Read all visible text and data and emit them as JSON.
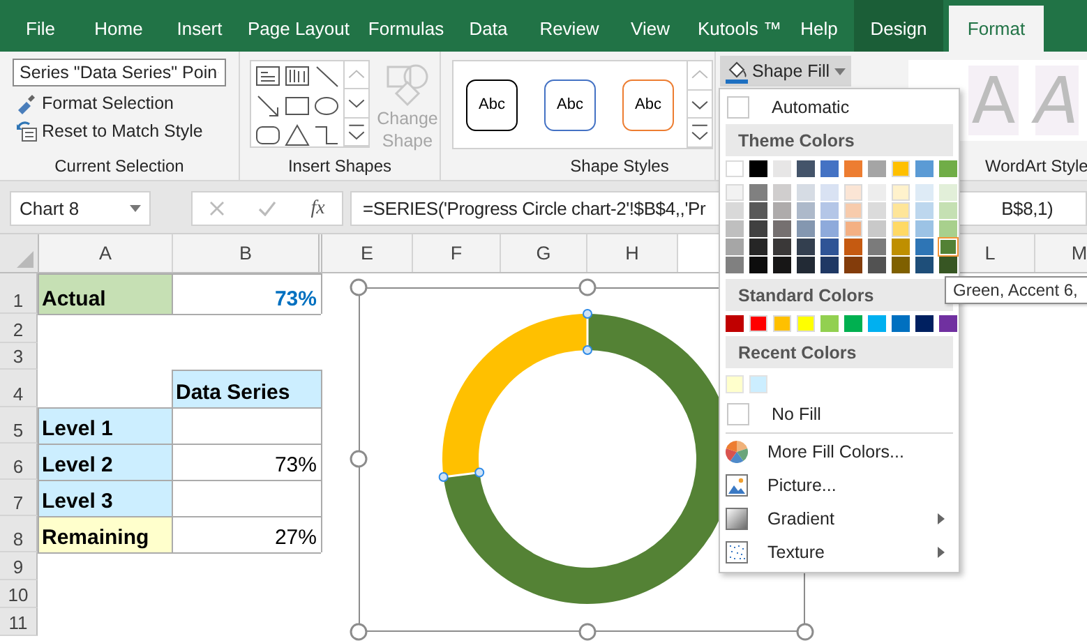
{
  "tabs": [
    {
      "label": "File",
      "kind": "normal",
      "selected": false
    },
    {
      "label": "Home",
      "kind": "normal",
      "selected": false
    },
    {
      "label": "Insert",
      "kind": "normal",
      "selected": false
    },
    {
      "label": "Page Layout",
      "kind": "normal",
      "selected": false
    },
    {
      "label": "Formulas",
      "kind": "normal",
      "selected": false
    },
    {
      "label": "Data",
      "kind": "normal",
      "selected": false
    },
    {
      "label": "Review",
      "kind": "normal",
      "selected": false
    },
    {
      "label": "View",
      "kind": "normal",
      "selected": false
    },
    {
      "label": "Kutools ™",
      "kind": "normal",
      "selected": false
    },
    {
      "label": "Help",
      "kind": "normal",
      "selected": false
    },
    {
      "label": "Design",
      "kind": "context",
      "selected": false
    },
    {
      "label": "Format",
      "kind": "context",
      "selected": true
    }
  ],
  "ribbon": {
    "current_selection": {
      "dropdown": "Series \"Data Series\" Poin",
      "format_selection": "Format Selection",
      "reset": "Reset to Match Style",
      "label": "Current Selection"
    },
    "insert_shapes": {
      "change_shape": {
        "label": "Change Shape",
        "disabled": true
      },
      "label": "Insert Shapes"
    },
    "shape_styles": {
      "presets": [
        {
          "text": "Abc",
          "color": "#000000"
        },
        {
          "text": "Abc",
          "color": "#4472c4"
        },
        {
          "text": "Abc",
          "color": "#ed7d31"
        }
      ],
      "label": "Shape Styles"
    },
    "shape_fill": {
      "label": "Shape Fill",
      "expanded": true
    },
    "wordart_styles": {
      "samples": [
        "A",
        "A"
      ],
      "label": "WordArt Style"
    }
  },
  "formula_bar": {
    "name_box": "Chart 8",
    "function_label": "fx",
    "formula": "=SERIES('Progress Circle chart-2'!$B$4,,'Pr",
    "formula_tail": "B$8,1)"
  },
  "sheet": {
    "columns": [
      "A",
      "B",
      "E",
      "F",
      "G",
      "H",
      "L",
      "M"
    ],
    "rows": [
      {
        "number": "1",
        "cells": [
          {
            "text": "Actual",
            "color": "#c6e0b4",
            "kind": "label"
          },
          {
            "text": "73%",
            "kind": "highlight"
          }
        ]
      },
      {
        "number": "2",
        "cells": []
      },
      {
        "number": "3",
        "cells": []
      },
      {
        "number": "4",
        "cells": [
          null,
          {
            "text": "Data Series",
            "color": "#cceeff",
            "kind": "label"
          }
        ]
      },
      {
        "number": "5",
        "cells": [
          {
            "text": "Level 1",
            "color": "#cceeff",
            "kind": "label"
          },
          {
            "kind": "value"
          }
        ]
      },
      {
        "number": "6",
        "cells": [
          {
            "text": "Level 2",
            "color": "#cceeff",
            "kind": "label"
          },
          {
            "text": "73%",
            "kind": "value"
          }
        ]
      },
      {
        "number": "7",
        "cells": [
          {
            "text": "Level 3",
            "color": "#cceeff",
            "kind": "label"
          },
          {
            "kind": "value"
          }
        ]
      },
      {
        "number": "8",
        "cells": [
          {
            "text": "Remaining",
            "color": "#ffffcc",
            "kind": "label"
          },
          {
            "text": "27%",
            "kind": "value"
          }
        ]
      },
      {
        "number": "9",
        "cells": []
      },
      {
        "number": "10",
        "cells": []
      },
      {
        "number": "11",
        "cells": []
      }
    ]
  },
  "fill_menu": {
    "automatic": "Automatic",
    "theme_title": "Theme Colors",
    "theme_colors": [
      {
        "color": "#ffffff",
        "selected": false,
        "shades": [
          {
            "color": "#f2f2f2",
            "selected": false
          },
          {
            "color": "#d9d9d9",
            "selected": false
          },
          {
            "color": "#bfbfbf",
            "selected": false
          },
          {
            "color": "#a6a6a6",
            "selected": false
          },
          {
            "color": "#808080",
            "selected": false
          }
        ]
      },
      {
        "color": "#000000",
        "selected": false,
        "shades": [
          {
            "color": "#808080",
            "selected": false
          },
          {
            "color": "#595959",
            "selected": false
          },
          {
            "color": "#404040",
            "selected": false
          },
          {
            "color": "#262626",
            "selected": false
          },
          {
            "color": "#0d0d0d",
            "selected": false
          }
        ]
      },
      {
        "color": "#e7e6e6",
        "selected": false,
        "shades": [
          {
            "color": "#d0cece",
            "selected": false
          },
          {
            "color": "#aeabab",
            "selected": false
          },
          {
            "color": "#757070",
            "selected": false
          },
          {
            "color": "#3a3838",
            "selected": false
          },
          {
            "color": "#171616",
            "selected": false
          }
        ]
      },
      {
        "color": "#44546a",
        "selected": false,
        "shades": [
          {
            "color": "#d6dce4",
            "selected": false
          },
          {
            "color": "#adb9ca",
            "selected": false
          },
          {
            "color": "#8497b0",
            "selected": false
          },
          {
            "color": "#333f4f",
            "selected": false
          },
          {
            "color": "#222a35",
            "selected": false
          }
        ]
      },
      {
        "color": "#4472c4",
        "selected": false,
        "shades": [
          {
            "color": "#d9e2f3",
            "selected": false
          },
          {
            "color": "#b4c6e7",
            "selected": false
          },
          {
            "color": "#8eaadb",
            "selected": false
          },
          {
            "color": "#2f5496",
            "selected": false
          },
          {
            "color": "#1f3864",
            "selected": false
          }
        ]
      },
      {
        "color": "#ed7d31",
        "selected": false,
        "shades": [
          {
            "color": "#fbe5d5",
            "selected": false
          },
          {
            "color": "#f7cbac",
            "selected": false
          },
          {
            "color": "#f4b083",
            "selected": false
          },
          {
            "color": "#c55a11",
            "selected": false
          },
          {
            "color": "#833c0b",
            "selected": false
          }
        ]
      },
      {
        "color": "#a5a5a5",
        "selected": false,
        "shades": [
          {
            "color": "#ededed",
            "selected": false
          },
          {
            "color": "#dbdbdb",
            "selected": false
          },
          {
            "color": "#c9c9c9",
            "selected": false
          },
          {
            "color": "#7b7b7b",
            "selected": false
          },
          {
            "color": "#525252",
            "selected": false
          }
        ]
      },
      {
        "color": "#ffc000",
        "selected": false,
        "shades": [
          {
            "color": "#fff2cc",
            "selected": false
          },
          {
            "color": "#fee599",
            "selected": false
          },
          {
            "color": "#ffd965",
            "selected": false
          },
          {
            "color": "#bf8f00",
            "selected": false
          },
          {
            "color": "#7f6000",
            "selected": false
          }
        ]
      },
      {
        "color": "#5b9bd5",
        "selected": false,
        "shades": [
          {
            "color": "#deebf6",
            "selected": false
          },
          {
            "color": "#bdd7ee",
            "selected": false
          },
          {
            "color": "#9cc3e5",
            "selected": false
          },
          {
            "color": "#2e75b5",
            "selected": false
          },
          {
            "color": "#1e4e79",
            "selected": false
          }
        ]
      },
      {
        "color": "#70ad47",
        "selected": false,
        "shades": [
          {
            "color": "#e2efd9",
            "selected": false
          },
          {
            "color": "#c5e0b3",
            "selected": false
          },
          {
            "color": "#a8d08d",
            "selected": false
          },
          {
            "color": "#538135",
            "selected": true
          },
          {
            "color": "#375623",
            "selected": false
          }
        ]
      }
    ],
    "standard_title": "Standard Colors",
    "standard_colors": [
      {
        "color": "#c00000",
        "selected": false
      },
      {
        "color": "#ff0000",
        "selected": false
      },
      {
        "color": "#ffc000",
        "selected": false
      },
      {
        "color": "#ffff00",
        "selected": false
      },
      {
        "color": "#92d050",
        "selected": false
      },
      {
        "color": "#00b050",
        "selected": false
      },
      {
        "color": "#00b0f0",
        "selected": false
      },
      {
        "color": "#0070c0",
        "selected": false
      },
      {
        "color": "#002060",
        "selected": false
      },
      {
        "color": "#7030a0",
        "selected": false
      }
    ],
    "recent_title": "Recent Colors",
    "recent_colors": [
      {
        "color": "#ffffcc",
        "selected": false
      },
      {
        "color": "#cceeff",
        "selected": false
      }
    ],
    "items": [
      {
        "label": "No Fill",
        "kind": "none",
        "submenu": false
      },
      {
        "label": "More Fill Colors...",
        "kind": "palette",
        "submenu": false
      },
      {
        "label": "Picture...",
        "kind": "picture",
        "submenu": false
      },
      {
        "label": "Gradient",
        "kind": "gradient",
        "submenu": true
      },
      {
        "label": "Texture",
        "kind": "texture",
        "submenu": true
      }
    ]
  },
  "tooltip": "Green, Accent 6,"
}
